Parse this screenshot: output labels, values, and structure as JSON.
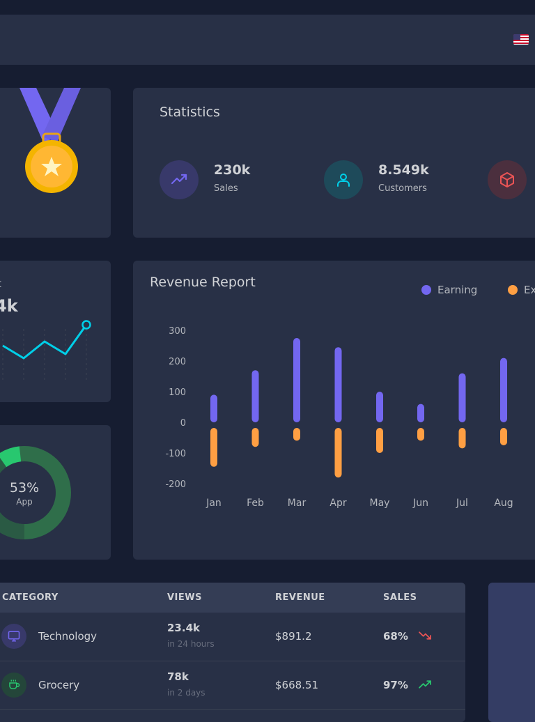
{
  "colors": {
    "earning": "#7367f0",
    "expense": "#ff9f43",
    "cyan": "#00cfe8",
    "green": "#28c76f",
    "red": "#ea5455"
  },
  "navbar": {
    "flag_icon": "us-flag-icon"
  },
  "statistics": {
    "title": "Statistics",
    "items": [
      {
        "value": "230k",
        "label": "Sales",
        "icon": "trending-up-icon"
      },
      {
        "value": "8.549k",
        "label": "Customers",
        "icon": "user-icon"
      },
      {
        "value": "",
        "label": "",
        "icon": "box-icon"
      }
    ]
  },
  "medal": {
    "icon": "medal-icon"
  },
  "line_widget": {
    "title": "t",
    "value": "4k"
  },
  "donut_widget": {
    "percent": "53%",
    "label": "App",
    "fraction": 0.53
  },
  "revenue_report": {
    "title": "Revenue Report",
    "legend": {
      "earning": "Earning",
      "expense": "Ex"
    }
  },
  "table": {
    "headers": {
      "category": "CATEGORY",
      "views": "VIEWS",
      "revenue": "REVENUE",
      "sales": "SALES"
    },
    "rows": [
      {
        "category": "Technology",
        "views": "23.4k",
        "views_sub": "in 24 hours",
        "revenue": "$891.2",
        "sales": "68%",
        "trend": "down",
        "icon": "monitor-icon"
      },
      {
        "category": "Grocery",
        "views": "78k",
        "views_sub": "in 2 days",
        "revenue": "$668.51",
        "sales": "97%",
        "trend": "up",
        "icon": "coffee-icon"
      }
    ]
  },
  "chart_data": [
    {
      "type": "line",
      "x": [
        1,
        2,
        3,
        4,
        5
      ],
      "values": [
        160,
        100,
        180,
        120,
        260
      ],
      "title": "",
      "xlabel": "",
      "ylabel": "",
      "grid": true
    },
    {
      "type": "bar",
      "title": "Revenue Report",
      "categories": [
        "Jan",
        "Feb",
        "Mar",
        "Apr",
        "May",
        "Jun",
        "Jul",
        "Aug"
      ],
      "series": [
        {
          "name": "Earning",
          "values": [
            90,
            170,
            275,
            245,
            100,
            60,
            160,
            210
          ]
        },
        {
          "name": "Ex",
          "values": [
            -145,
            -80,
            -60,
            -180,
            -100,
            -60,
            -85,
            -75
          ]
        }
      ],
      "yticks": [
        300,
        200,
        100,
        0,
        -100,
        -200
      ],
      "ylim": [
        -200,
        300
      ],
      "legend": "top-right",
      "grid": false
    }
  ]
}
